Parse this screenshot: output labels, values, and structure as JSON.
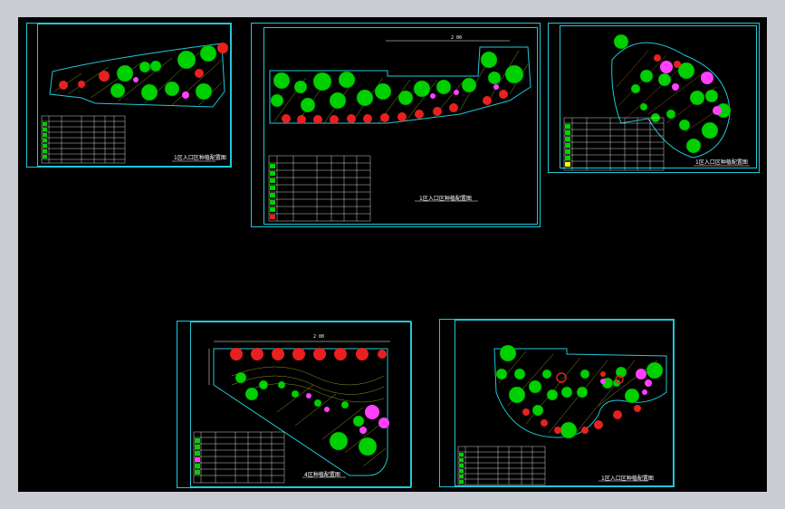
{
  "app": {
    "background_color": "#c9ccd3",
    "viewport_color": "#000000",
    "frame_color": "#20c8d8"
  },
  "sheets": [
    {
      "id": "sheet-1",
      "title": "1区入口区种植配置图"
    },
    {
      "id": "sheet-2",
      "title": "1区入口区种植配置图",
      "dimension": "2 00"
    },
    {
      "id": "sheet-3",
      "title": "1区入口区种植配置图"
    },
    {
      "id": "sheet-4",
      "title": "4区种植配置图",
      "dimension": "2 00"
    },
    {
      "id": "sheet-5",
      "title": "1区入口区种植配置图"
    }
  ],
  "palette": {
    "tree_green": "#00d000",
    "tree_red": "#e82020",
    "shrub_magenta": "#ff40ff",
    "hatch_yellow": "#c8c820",
    "table_line": "#ffffff"
  }
}
